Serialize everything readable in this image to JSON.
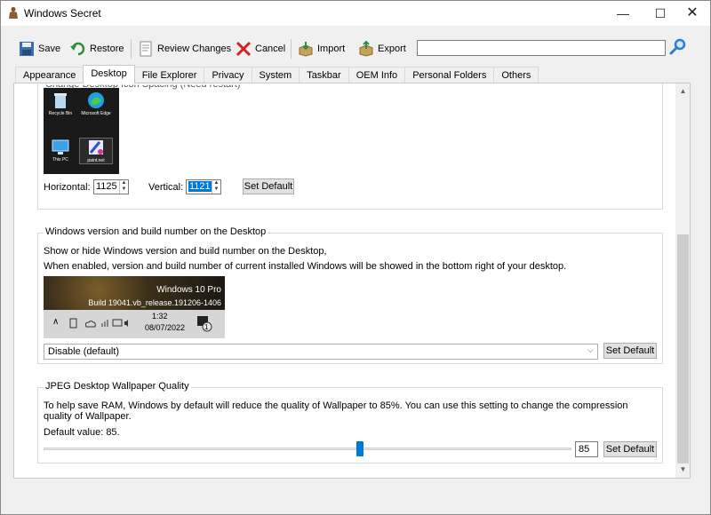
{
  "window": {
    "title": "Windows Secret",
    "minimize_glyph": "—",
    "maximize_glyph": "☐",
    "close_glyph": "✕"
  },
  "toolbar": {
    "save_label": "Save",
    "restore_label": "Restore",
    "review_label": "Review Changes",
    "cancel_label": "Cancel",
    "import_label": "Import",
    "export_label": "Export",
    "search_value": ""
  },
  "tabs": [
    {
      "label": "Appearance",
      "active": false
    },
    {
      "label": "Desktop",
      "active": true
    },
    {
      "label": "File Explorer",
      "active": false
    },
    {
      "label": "Privacy",
      "active": false
    },
    {
      "label": "System",
      "active": false
    },
    {
      "label": "Taskbar",
      "active": false
    },
    {
      "label": "OEM Info",
      "active": false
    },
    {
      "label": "Personal Folders",
      "active": false
    },
    {
      "label": "Others",
      "active": false
    }
  ],
  "icon_spacing": {
    "partial_title": "Change Desktop Icon Spacing (Need restart)",
    "preview_icons": [
      "Recycle Bin",
      "Microsoft Edge",
      "This PC",
      "paint.net"
    ],
    "horizontal_label": "Horizontal:",
    "horizontal_value": "1125",
    "vertical_label": "Vertical:",
    "vertical_value": "1121",
    "set_default_label": "Set Default"
  },
  "build_number": {
    "title": "Windows version and build number on the Desktop",
    "desc1": "Show or hide Windows version and build number on the Desktop,",
    "desc2": "When enabled, version and build number of current installed Windows will be showed in the bottom right of your desktop.",
    "preview_line1": "Windows 10 Pro",
    "preview_line2": "Build 19041.vb_release.191206-1406",
    "preview_time": "1:32",
    "preview_date": "08/07/2022",
    "preview_badge": "1",
    "select_value": "Disable (default)",
    "set_default_label": "Set Default"
  },
  "jpeg_quality": {
    "title": "JPEG Desktop Wallpaper Quality",
    "desc": "To help save RAM, Windows by default will reduce the quality of Wallpaper to 85%. You can use this setting to change the compression quality of Wallpaper.",
    "default_text": "Default value: 85.",
    "value": "85",
    "slider_fraction": 0.6,
    "set_default_label": "Set Default"
  },
  "colors": {
    "accent": "#0078d7",
    "selection": "#0078d7"
  }
}
